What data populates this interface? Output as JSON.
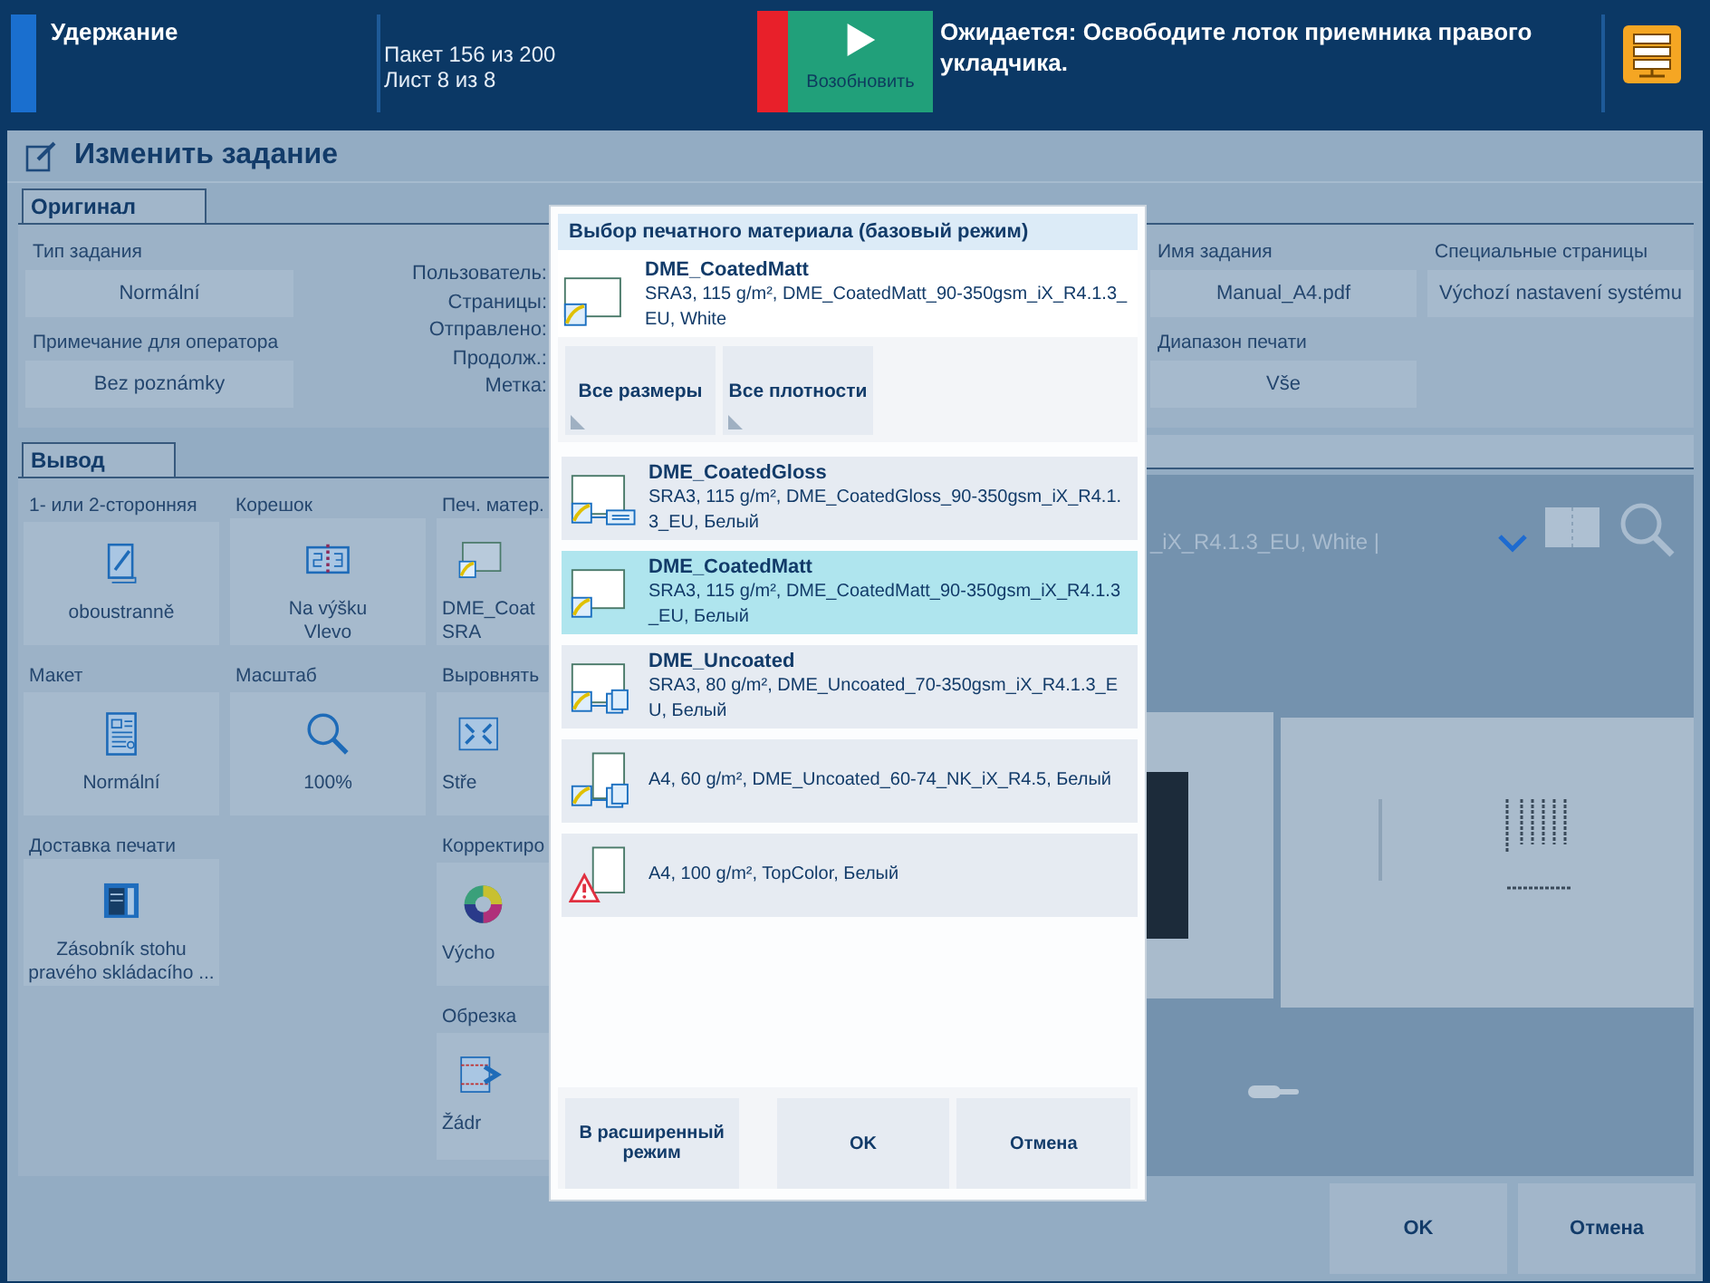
{
  "status_bar": {
    "state": "Удержание",
    "batch": "Пакет 156 из 200",
    "sheet": "Лист 8 из 8",
    "resume_button": "Возобновить",
    "message": "Ожидается: Освободите лоток приемника правого укладчика."
  },
  "window": {
    "title": "Изменить задание"
  },
  "original": {
    "tab": "Оригинал",
    "fields": [
      {
        "label": "Тип задания",
        "value": "Normální"
      },
      {
        "label": "Примечание для оператора",
        "value": "Bez poznámky"
      }
    ],
    "info_labels": [
      "Пользователь:",
      "Страницы:",
      "Отправлено:",
      "Продолж.:",
      "Метка:"
    ]
  },
  "job": {
    "fields": [
      {
        "label": "Имя задания",
        "value": "Manual_A4.pdf"
      },
      {
        "label": "Специальные страницы",
        "value": "Výchozí nastavení systému"
      },
      {
        "label": "Диапазон печати",
        "value": "Vše"
      }
    ]
  },
  "output": {
    "tab": "Вывод",
    "columns": [
      [
        {
          "label": "1- или 2-сторонняя",
          "kind": "duplex",
          "lines": [
            "oboustranně"
          ]
        },
        {
          "label": "Макет",
          "kind": "layout",
          "lines": [
            "Normální"
          ]
        },
        {
          "label": "Доставка печати",
          "kind": "delivery",
          "lines": [
            "Zásobník stohu pravého skládacího ..."
          ]
        }
      ],
      [
        {
          "label": "Корешок",
          "kind": "binding",
          "lines": [
            "Na výšku",
            "Vlevo"
          ]
        },
        {
          "label": "Масштаб",
          "kind": "zoom",
          "lines": [
            "100%"
          ]
        }
      ],
      [
        {
          "label": "Печ. матер.",
          "kind": "media",
          "lines": [
            "DME_Coat",
            "SRA"
          ]
        },
        {
          "label": "Выровнять",
          "kind": "align",
          "lines": [
            "Stře"
          ]
        },
        {
          "label": "Корректиро",
          "kind": "color",
          "lines": [
            "Výcho"
          ]
        },
        {
          "label": "Обрезка",
          "kind": "trim",
          "lines": [
            "Žádr"
          ]
        }
      ]
    ]
  },
  "preview": {
    "caption": "_iX_R4.1.3_EU, White |"
  },
  "dialog": {
    "title": "Выбор печатного материала (базовый режим)",
    "current": {
      "name": "DME_CoatedMatt",
      "description": "SRA3, 115 g/m², DME_CoatedMatt_90-350gsm_iX_R4.1.3_EU, White"
    },
    "filters": [
      "Все размеры",
      "Все плотности"
    ],
    "items": [
      {
        "name": "DME_CoatedGloss",
        "description": "SRA3, 115 g/m², DME_CoatedGloss_90-350gsm_iX_R4.1.3_EU, Белый",
        "kind": "sra3-tray",
        "selected": false
      },
      {
        "name": "DME_CoatedMatt",
        "description": "SRA3, 115 g/m², DME_CoatedMatt_90-350gsm_iX_R4.1.3_EU, Белый",
        "kind": "sra3",
        "selected": true
      },
      {
        "name": "DME_Uncoated",
        "description": "SRA3, 80 g/m², DME_Uncoated_70-350gsm_iX_R4.1.3_EU, Белый",
        "kind": "sra3-stack",
        "selected": false
      },
      {
        "description": "A4, 60 g/m², DME_Uncoated_60-74_NK_iX_R4.5, Белый",
        "kind": "a4-stack",
        "selected": false
      },
      {
        "description": "A4, 100 g/m², TopColor, Белый",
        "kind": "a4-warning",
        "selected": false
      }
    ],
    "advanced_button": "В расширенный режим",
    "ok_button": "OK",
    "cancel_button": "Отмена"
  },
  "footer": {
    "ok_button": "OK",
    "cancel_button": "Отмена"
  }
}
